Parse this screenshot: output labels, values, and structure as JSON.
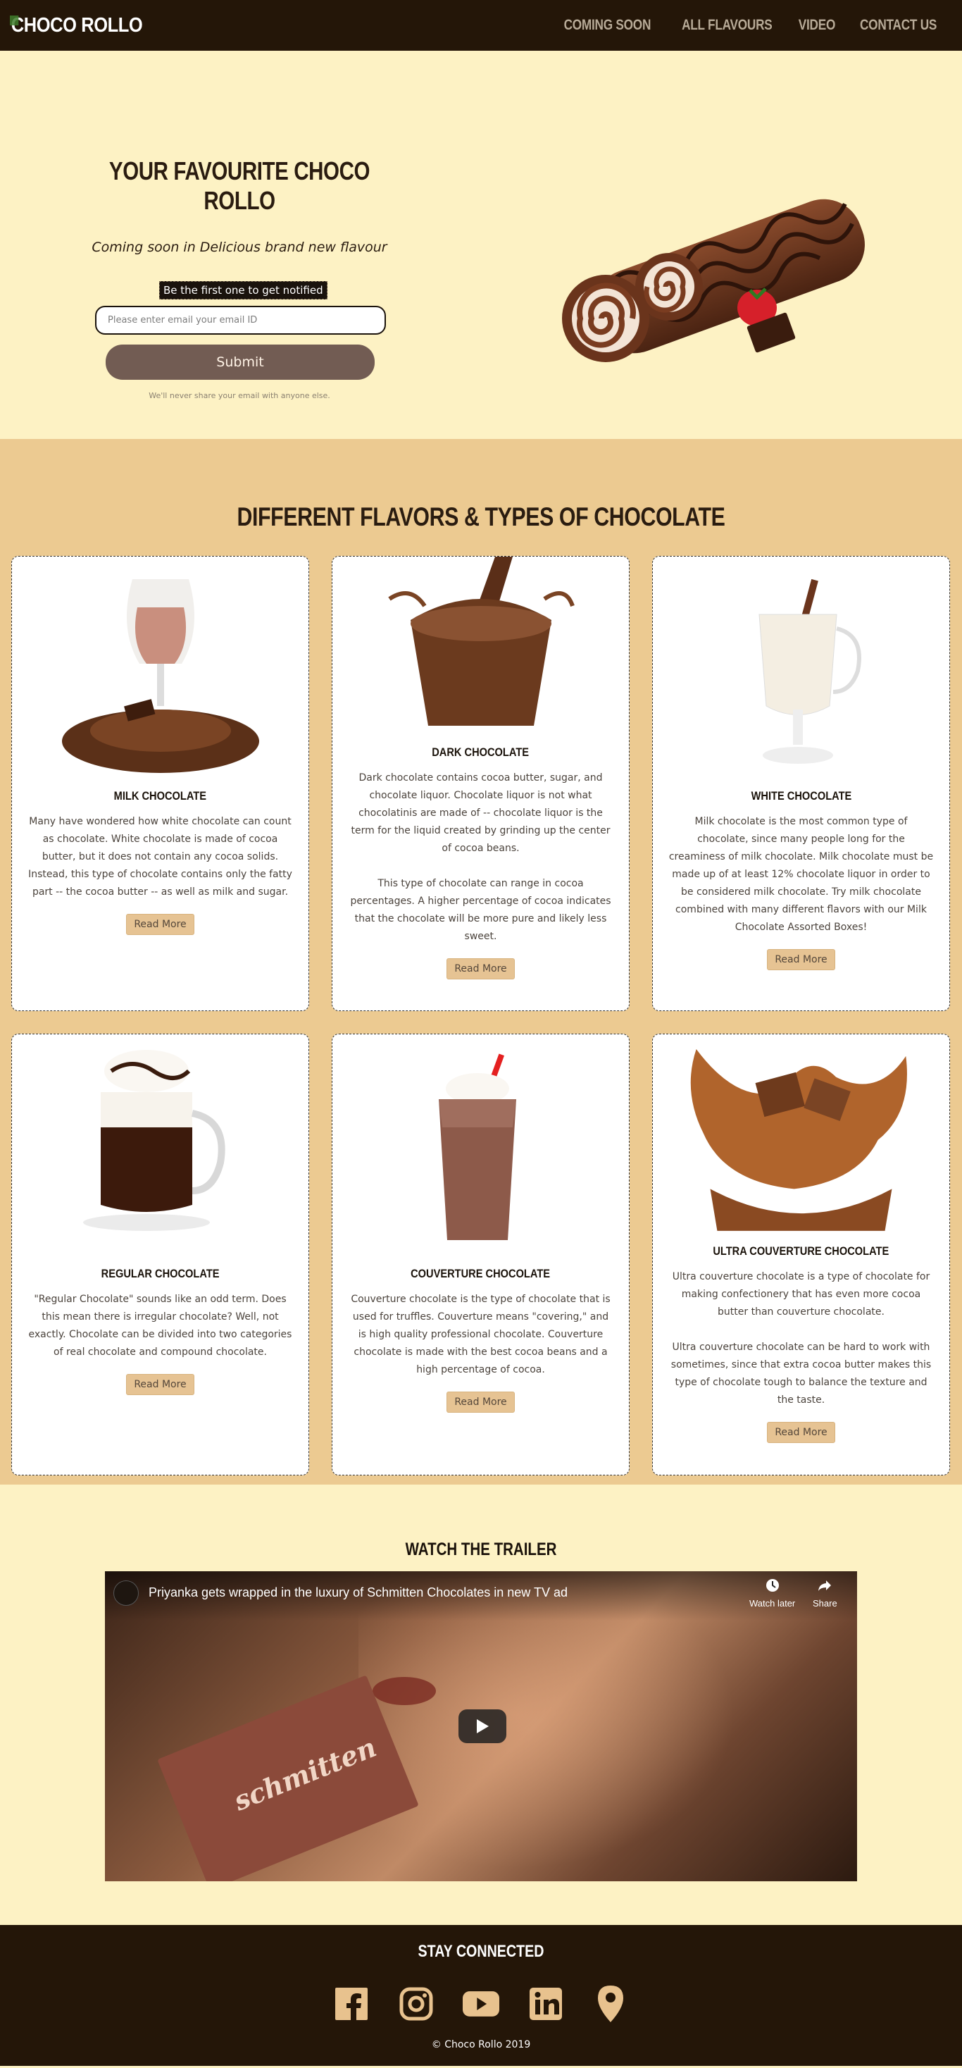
{
  "nav": {
    "brand": "CHOCO ROLLO",
    "links": [
      "COMING SOON",
      "ALL FLAVOURS",
      "VIDEO",
      "CONTACT US"
    ]
  },
  "hero": {
    "title": "YOUR FAVOURITE CHOCO ROLLO",
    "subtitle": "Coming soon in Delicious brand new flavour",
    "notify_label": "Be the first one to get notified",
    "email_placeholder": "Please enter email your email ID",
    "submit_label": "Submit",
    "privacy_note": "We'll never share your email with anyone else."
  },
  "flavors": {
    "title": "DIFFERENT FLAVORS & TYPES OF CHOCOLATE",
    "read_more_label": "Read More",
    "cards": [
      {
        "title": "MILK CHOCOLATE",
        "paragraphs": [
          "Many have wondered how white chocolate can count as chocolate. White chocolate is made of cocoa butter, but it does not contain any cocoa solids. Instead, this type of chocolate contains only the fatty part -- the cocoa butter -- as well as milk and sugar."
        ]
      },
      {
        "title": "DARK CHOCOLATE",
        "paragraphs": [
          "Dark chocolate contains cocoa butter, sugar, and chocolate liquor. Chocolate liquor is not what chocolatinis are made of -- chocolate liquor is the term for the liquid created by grinding up the center of cocoa beans.",
          "This type of chocolate can range in cocoa percentages. A higher percentage of cocoa indicates that the chocolate will be more pure and likely less sweet."
        ]
      },
      {
        "title": "WHITE CHOCOLATE",
        "paragraphs": [
          "Milk chocolate is the most common type of chocolate, since many people long for the creaminess of milk chocolate. Milk chocolate must be made up of at least 12% chocolate liquor in order to be considered milk chocolate. Try milk chocolate combined with many different flavors with our Milk Chocolate Assorted Boxes!"
        ]
      },
      {
        "title": "REGULAR CHOCOLATE",
        "paragraphs": [
          "\"Regular Chocolate\" sounds like an odd term. Does this mean there is irregular chocolate? Well, not exactly. Chocolate can be divided into two categories of real chocolate and compound chocolate."
        ]
      },
      {
        "title": "COUVERTURE CHOCOLATE",
        "paragraphs": [
          "Couverture chocolate is the type of chocolate that is used for truffles. Couverture means \"covering,\" and is high quality professional chocolate. Couverture chocolate is made with the best cocoa beans and a high percentage of cocoa."
        ]
      },
      {
        "title": "ULTRA COUVERTURE CHOCOLATE",
        "paragraphs": [
          "Ultra couverture chocolate is a type of chocolate for making confectionery that has even more cocoa butter than couverture chocolate.",
          "Ultra couverture chocolate can be hard to work with sometimes, since that extra cocoa butter makes this type of chocolate tough to balance the texture and the taste."
        ]
      }
    ]
  },
  "trailer": {
    "title": "WATCH THE TRAILER",
    "video_title": "Priyanka gets wrapped in the luxury of Schmitten Chocolates in new TV ad",
    "watch_later_label": "Watch later",
    "share_label": "Share",
    "pack_text": "schmitten"
  },
  "footer": {
    "title": "STAY CONNECTED",
    "socials": [
      "facebook-icon",
      "instagram-icon",
      "youtube-icon",
      "linkedin-icon",
      "location-icon"
    ],
    "copyright": "© Choco Rollo 2019"
  },
  "colors": {
    "nav_bg": "#241608",
    "hero_bg": "#fdf2c4",
    "flavors_bg": "#ecca91",
    "submit_bg": "#725c53",
    "read_more_bg": "#e6c393",
    "social_icon": "#e8c28e"
  }
}
